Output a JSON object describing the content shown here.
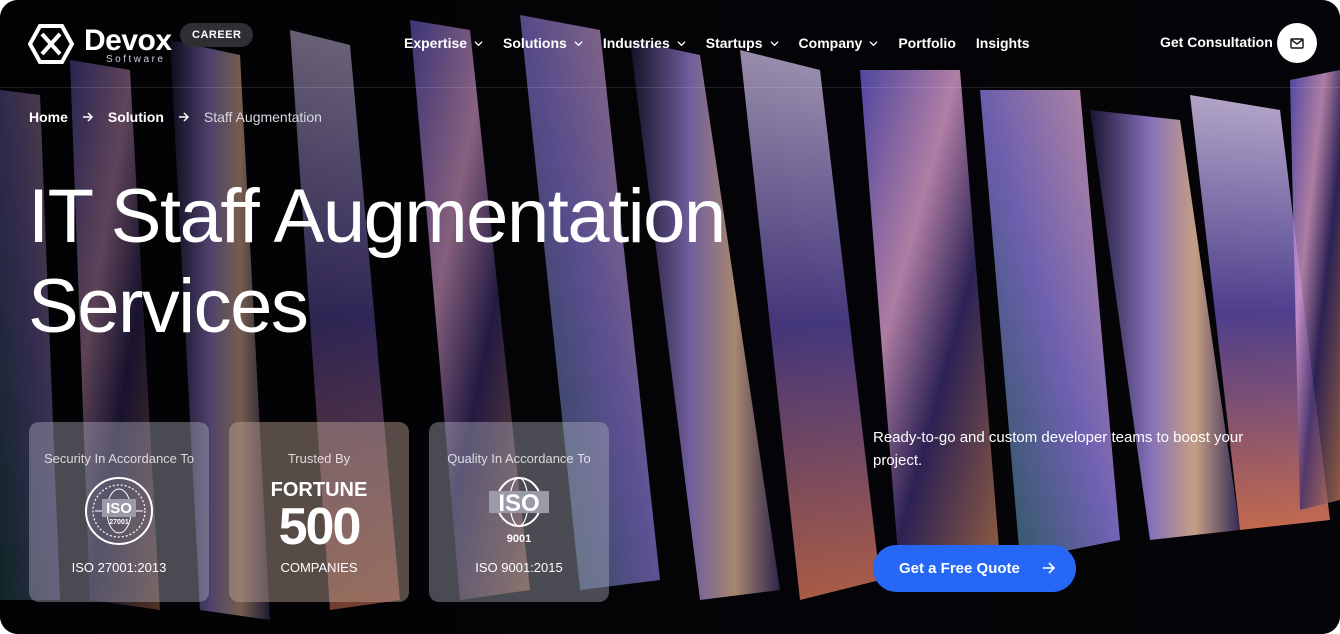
{
  "header": {
    "logo_name": "Devox",
    "logo_sub": "Software",
    "career_badge": "CAREER",
    "nav": [
      {
        "label": "Expertise",
        "has_dropdown": true
      },
      {
        "label": "Solutions",
        "has_dropdown": true
      },
      {
        "label": "Industries",
        "has_dropdown": true
      },
      {
        "label": "Startups",
        "has_dropdown": true
      },
      {
        "label": "Company",
        "has_dropdown": true
      },
      {
        "label": "Portfolio",
        "has_dropdown": false
      },
      {
        "label": "Insights",
        "has_dropdown": false
      }
    ],
    "consultation_label": "Get Consultation",
    "mail_icon": "mail-icon"
  },
  "breadcrumb": [
    "Home",
    "Solution",
    "Staff Augmentation"
  ],
  "hero": {
    "title_line1": "IT Staff Augmentation",
    "title_line2": "Services",
    "tagline": "Ready-to-go and custom developer teams to boost your project."
  },
  "cards": [
    {
      "top": "Security In Accordance To",
      "logo_text": "ISO",
      "logo_sub": "27001",
      "bottom": "ISO 27001:2013"
    },
    {
      "top": "Trusted By",
      "logo_text": "FORTUNE",
      "logo_sub": "500",
      "bottom": "COMPANIES"
    },
    {
      "top": "Quality In Accordance To",
      "logo_text": "ISO",
      "logo_sub": "9001",
      "bottom": "ISO 9001:2015"
    }
  ],
  "cta": {
    "label": "Get a Free Quote",
    "icon": "arrow-right-icon"
  },
  "colors": {
    "accent": "#2667f5",
    "background": "#050509",
    "card": "#9a9aa8"
  }
}
